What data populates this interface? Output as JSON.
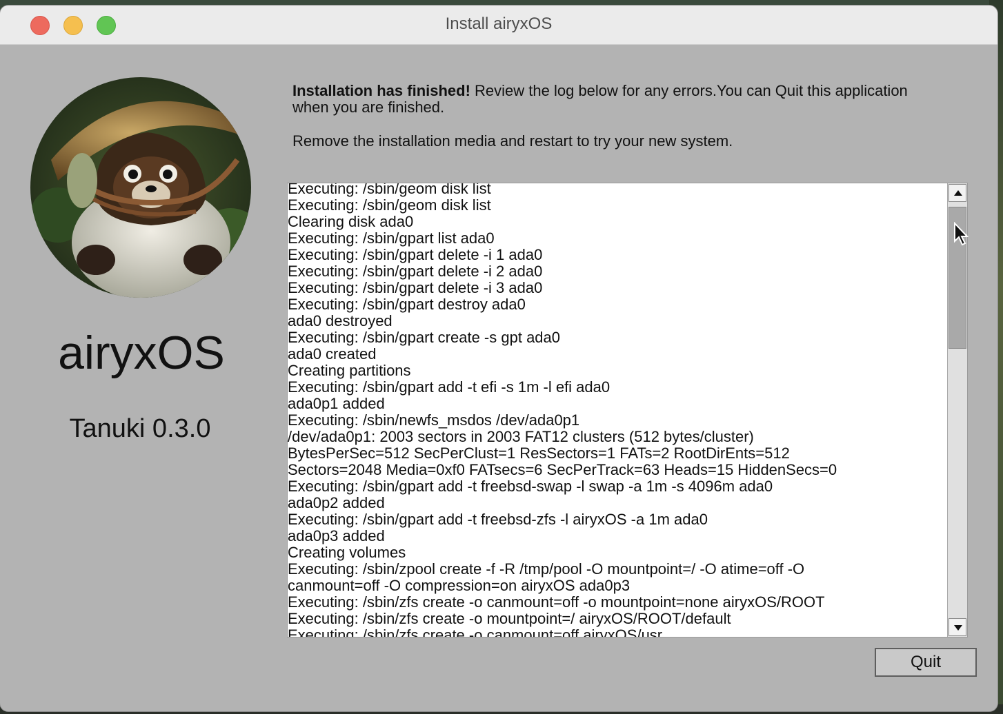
{
  "window": {
    "title": "Install airyxOS"
  },
  "sidebar": {
    "logo_icon": "tanuki-figurine-logo",
    "app_name": "airyxOS",
    "version": "Tanuki 0.3.0"
  },
  "message": {
    "bold": "Installation has finished!",
    "text": " Review the log below for any errors.You can Quit this application when you are finished.",
    "restart_note": "Remove the installation media and restart to try your new system."
  },
  "log": {
    "lines": [
      "Executing: /sbin/geom disk list",
      "Executing: /sbin/geom disk list",
      "Clearing disk ada0",
      "Executing: /sbin/gpart list ada0",
      "Executing: /sbin/gpart delete -i 1 ada0",
      "Executing: /sbin/gpart delete -i 2 ada0",
      "Executing: /sbin/gpart delete -i 3 ada0",
      "Executing: /sbin/gpart destroy ada0",
      "ada0 destroyed",
      "Executing: /sbin/gpart create -s gpt ada0",
      "ada0 created",
      "Creating partitions",
      "Executing: /sbin/gpart add -t efi -s 1m -l efi ada0",
      "ada0p1 added",
      "Executing: /sbin/newfs_msdos /dev/ada0p1",
      "/dev/ada0p1: 2003 sectors in 2003 FAT12 clusters (512 bytes/cluster)",
      "BytesPerSec=512 SecPerClust=1 ResSectors=1 FATs=2 RootDirEnts=512",
      "Sectors=2048 Media=0xf0 FATsecs=6 SecPerTrack=63 Heads=15 HiddenSecs=0",
      "Executing: /sbin/gpart add -t freebsd-swap -l swap -a 1m -s 4096m ada0",
      "ada0p2 added",
      "Executing: /sbin/gpart add -t freebsd-zfs -l airyxOS -a 1m ada0",
      "ada0p3 added",
      "Creating volumes",
      "Executing: /sbin/zpool create -f -R /tmp/pool -O mountpoint=/ -O atime=off -O",
      "canmount=off -O compression=on airyxOS ada0p3",
      "Executing: /sbin/zfs create -o canmount=off -o mountpoint=none airyxOS/ROOT",
      "Executing: /sbin/zfs create -o mountpoint=/ airyxOS/ROOT/default",
      "Executing: /sbin/zfs create -o canmount=off airyxOS/usr"
    ]
  },
  "buttons": {
    "quit_label": "Quit"
  },
  "colors": {
    "window_bg": "#b3b3b3",
    "titlebar_bg": "#ebebeb",
    "close": "#ed6a5e",
    "minimize": "#f5bf4f",
    "maximize": "#61c554"
  }
}
